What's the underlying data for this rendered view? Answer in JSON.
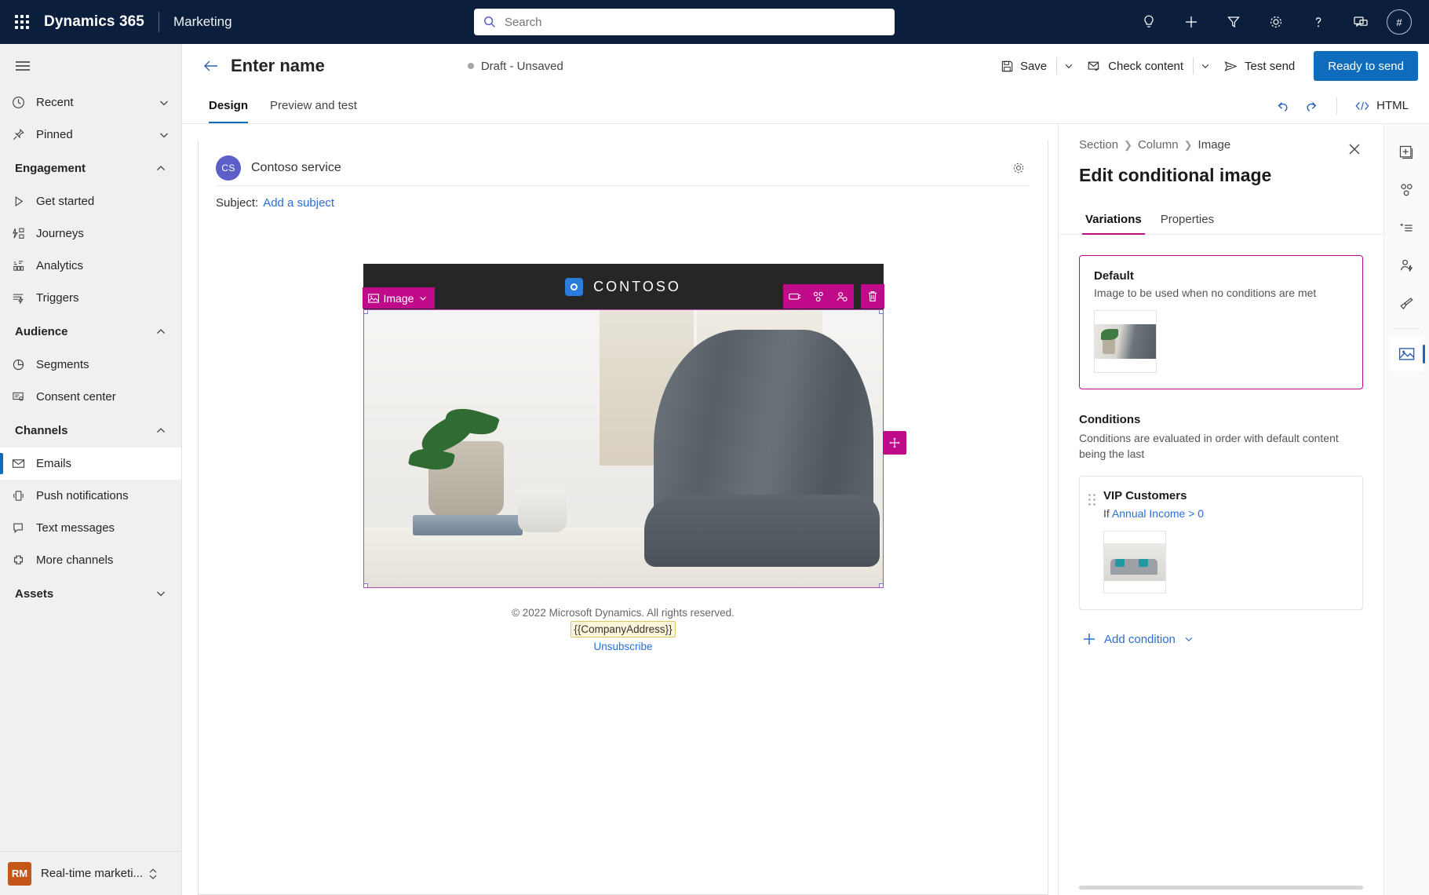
{
  "topbar": {
    "waffle_label": "App launcher",
    "brand": "Dynamics 365",
    "app_name": "Marketing",
    "search_placeholder": "Search",
    "search_value": "",
    "icons": [
      "lightbulb-icon",
      "plus-icon",
      "filter-icon",
      "gear-icon",
      "help-icon",
      "feedback-icon"
    ],
    "avatar_initial": "#"
  },
  "sidebar": {
    "items": [
      {
        "label": "Recent",
        "icon": "clock-icon",
        "type": "expandable"
      },
      {
        "label": "Pinned",
        "icon": "pin-icon",
        "type": "expandable"
      },
      {
        "label": "Engagement",
        "type": "group",
        "expanded": true
      },
      {
        "label": "Get started",
        "icon": "play-icon",
        "type": "link"
      },
      {
        "label": "Journeys",
        "icon": "journeys-icon",
        "type": "link"
      },
      {
        "label": "Analytics",
        "icon": "analytics-icon",
        "type": "link"
      },
      {
        "label": "Triggers",
        "icon": "triggers-icon",
        "type": "link"
      },
      {
        "label": "Audience",
        "type": "group",
        "expanded": true
      },
      {
        "label": "Segments",
        "icon": "segments-icon",
        "type": "link"
      },
      {
        "label": "Consent center",
        "icon": "consent-icon",
        "type": "link"
      },
      {
        "label": "Channels",
        "type": "group",
        "expanded": true
      },
      {
        "label": "Emails",
        "icon": "mail-icon",
        "type": "link",
        "selected": true
      },
      {
        "label": "Push notifications",
        "icon": "push-icon",
        "type": "link"
      },
      {
        "label": "Text messages",
        "icon": "sms-icon",
        "type": "link"
      },
      {
        "label": "More channels",
        "icon": "more-channels-icon",
        "type": "link"
      },
      {
        "label": "Assets",
        "type": "group",
        "expanded": false
      }
    ],
    "app_switcher": {
      "badge": "RM",
      "label": "Real-time marketi..."
    }
  },
  "commandbar": {
    "record_title": "Enter name",
    "status": "Draft - Unsaved",
    "save_label": "Save",
    "check_content_label": "Check content",
    "test_send_label": "Test send",
    "ready_label": "Ready to send",
    "primary_color": "#0f6cbd"
  },
  "tabs": {
    "items": [
      {
        "label": "Design",
        "active": true
      },
      {
        "label": "Preview and test",
        "active": false
      }
    ],
    "undo_label": "Undo",
    "redo_label": "Redo",
    "html_label": "HTML"
  },
  "email": {
    "from_initials": "CS",
    "from_name": "Contoso service",
    "subject_label": "Subject:",
    "subject_link": "Add a subject",
    "brand_word": "CONTOSO",
    "block_tag": "Image",
    "footer": {
      "copyright": "© 2022 Microsoft Dynamics. All rights reserved.",
      "token": "{{CompanyAddress}}",
      "unsubscribe": "Unsubscribe"
    },
    "accent_color": "#bf0a8a",
    "actions": [
      "layers-icon",
      "branch-icon",
      "personalization-icon",
      "delete-icon"
    ],
    "move_handle": "move-icon"
  },
  "panel": {
    "breadcrumb": [
      "Section",
      "Column",
      "Image"
    ],
    "title": "Edit conditional image",
    "tabs": [
      {
        "label": "Variations",
        "active": true
      },
      {
        "label": "Properties",
        "active": false
      }
    ],
    "default": {
      "title": "Default",
      "subtitle": "Image to be used when no conditions are met",
      "thumbnail": "plant-and-chair-thumbnail"
    },
    "conditions": {
      "heading": "Conditions",
      "description": "Conditions are evaluated in order with default content being the last",
      "items": [
        {
          "name": "VIP Customers",
          "if_label": "If",
          "field": "Annual Income",
          "operator": ">",
          "value": "0",
          "thumbnail": "living-room-sofa-thumbnail"
        }
      ],
      "add_label": "Add condition"
    }
  },
  "rail": {
    "items": [
      {
        "icon": "add-element-icon",
        "active": false
      },
      {
        "icon": "branch-icon",
        "active": false
      },
      {
        "icon": "ai-list-icon",
        "active": false
      },
      {
        "icon": "personalization-icon",
        "active": false
      },
      {
        "icon": "brush-icon",
        "active": false
      },
      {
        "icon": "image-icon",
        "active": true
      }
    ]
  }
}
